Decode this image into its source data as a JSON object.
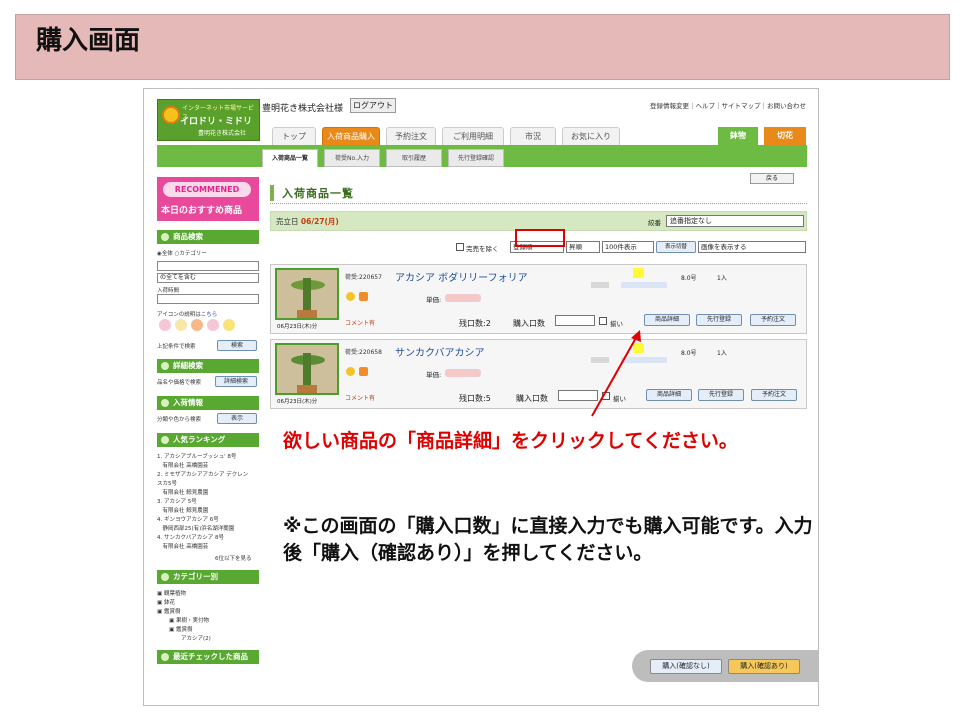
{
  "slide": {
    "title": "購入画面"
  },
  "header": {
    "logo_top": "インターネット市場サービス",
    "logo_name": "イロドリ・ミドリ",
    "logo_company": "豊明花き株式会社",
    "company_name": "豊明花き株式会社様",
    "logout_label": "ログアウト",
    "top_links": "登録情報変更｜ヘルプ｜サイトマップ｜お問い合わせ"
  },
  "tabs": [
    {
      "label": "トップ"
    },
    {
      "label": "入荷商品購入"
    },
    {
      "label": "予約注文"
    },
    {
      "label": "ご利用明細"
    },
    {
      "label": "市況"
    },
    {
      "label": "お気に入り"
    }
  ],
  "right_tabs": {
    "hachi": "鉢物",
    "kiri": "切花"
  },
  "subtabs": [
    {
      "label": "入荷商品一覧"
    },
    {
      "label": "荷受No.入力"
    },
    {
      "label": "取引履歴"
    },
    {
      "label": "先行登録確認"
    }
  ],
  "sidebar": {
    "recommend": "RECOMMENED",
    "recommend_sub": "本日のおすすめ商品",
    "product_search": "商品検索",
    "radio_all": "全体",
    "radio_cat": "カテゴリー",
    "select_all": "の全てを含む",
    "arrival_time": "入荷時間",
    "icon_help": "アイコンの説明は",
    "icon_help_link": "こちら",
    "search_cond": "上記条件で検索",
    "search_btn": "検索",
    "detail_search": "詳細検索",
    "detail_desc": "品名や価格で検索",
    "detail_btn": "詳細検索",
    "arrival_info": "入荷情報",
    "arrival_desc": "分類や色から検索",
    "show_btn": "表示",
    "ranking": "人気ランキング",
    "ranking_items": [
      "1. アカシアブルーブッシュ' 8号",
      "　有限会社 高橋園芸",
      "2. ミモザアカシアアカシア デクレン",
      "スカ5号",
      "　有限会社 鯨見農園",
      "3. アカシア 5号",
      "　有限会社 鯨見農園",
      "4. ギンヨウアカシア 6号",
      "　静岡西部25(有)浜名湖洋蘭園",
      "4. サンカクバアカシア 8号",
      "　有限会社 高橋園芸"
    ],
    "more_rank": "6位以下を見る",
    "category": "カテゴリー別",
    "cat_items": [
      "観葉植物",
      "鉢花",
      "鑑賞樹",
      "果樹・実付物",
      "鑑賞樹",
      "アカシア(2)"
    ],
    "recent": "最近チェックした商品"
  },
  "main": {
    "back_btn": "戻る",
    "page_title": "入荷商品一覧",
    "date_label": "売立日",
    "date_value": "06/27(月)",
    "sort_label": "絞番",
    "sort_value": "追番指定なし",
    "exclude_sold": "完売を除く",
    "order_field": "登録順",
    "order_dir": "昇順",
    "per_page": "100件表示",
    "view_toggle_btn": "表示切替",
    "image_mode": "画像を表示する"
  },
  "products": [
    {
      "ship_date": "06月23日(木)分",
      "code": "荷受:220657",
      "name": "アカシア ボダリリーフォリア",
      "price_label": "単価:",
      "comment": "コメント有",
      "stock": "残口数:2",
      "grade": "8.0号",
      "qty": "1入",
      "buy_label": "購入口数",
      "matome": "揃い",
      "detail_btn": "商品詳細",
      "advance_btn": "先行登録",
      "reserve_btn": "予約注文"
    },
    {
      "ship_date": "06月23日(木)分",
      "code": "荷受:220658",
      "name": "サンカクバアカシア",
      "price_label": "単価:",
      "comment": "コメント有",
      "stock": "残口数:5",
      "grade": "8.0号",
      "qty": "1入",
      "buy_label": "購入口数",
      "matome": "揃い",
      "detail_btn": "商品詳細",
      "advance_btn": "先行登録",
      "reserve_btn": "予約注文"
    }
  ],
  "buy_bar": {
    "no_confirm": "購入(確認なし)",
    "with_confirm": "購入(確認あり)"
  },
  "captions": {
    "click_instruction": "欲しい商品の「商品詳細」をクリックしてください。",
    "note": "※この画面の「購入口数」に直接入力でも購入可能です。入力後「購入（確認あり）」を押してください。"
  },
  "colors": {
    "accent_red": "#e00000",
    "green": "#6dbb43",
    "orange": "#e8891a",
    "title_bg": "#e6b9b9"
  }
}
